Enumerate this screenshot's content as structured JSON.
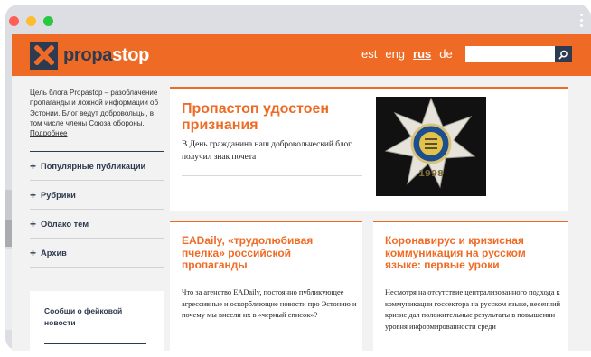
{
  "header": {
    "logo_part1": "propa",
    "logo_part2": "stop",
    "languages": [
      {
        "label": "est",
        "active": false
      },
      {
        "label": "eng",
        "active": false
      },
      {
        "label": "rus",
        "active": true
      },
      {
        "label": "de",
        "active": false
      }
    ],
    "search_placeholder": ""
  },
  "sidebar": {
    "intro": "Цель блога Propastop – разоблачение пропаганды и ложной информации об Эстонии. Блог ведут добровольцы, в том числе члены Союза обороны.",
    "more": "Подробнее",
    "items": [
      {
        "label": "Популярные публикации"
      },
      {
        "label": "Рубрики"
      },
      {
        "label": "Облако тем"
      },
      {
        "label": "Архив"
      }
    ],
    "report_box": "Сообщи о фейковой новости"
  },
  "featured": {
    "title": "Пропастоп удостоен признания",
    "excerpt": "В День гражданина наш добровольческий блог получил знак почета",
    "date": "",
    "image_year": "1998"
  },
  "articles": [
    {
      "title": "EADaily, «трудолюбивая пчелка» российской пропаганды",
      "excerpt": "Что за агенство EADaily, постоянно публикующее агрессивные и оскорбляющие новости про Эстонию и почему мы внесли их в «черный список»?"
    },
    {
      "title": "Коронавирус и кризисная коммуникация на русском языке: первые уроки",
      "excerpt": "Несмотря на отсутствие централизованного подхода к коммуникации госсектора на русском языке, весенний кризис дал положительные результаты в повышении уровня информированности среди"
    }
  ],
  "colors": {
    "accent": "#ef6b25",
    "navy": "#2d3a4f",
    "page_bg": "#f2f2f2"
  },
  "icons": {
    "logo": "x-cross-logo",
    "search": "search-icon",
    "menu": "more-vertical-icon"
  }
}
